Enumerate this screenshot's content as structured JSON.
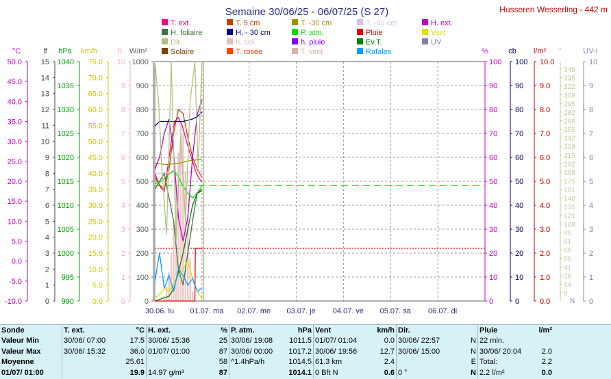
{
  "chart_data": {
    "type": "line",
    "title": "Semaine 30/06/25 - 06/07/25 (S 27)",
    "station": "Husseren Wesserling - 442 m",
    "x_tick_labels": [
      "30.06. lu",
      "01.07. ma",
      "02.07. me",
      "03.07. je",
      "04.07. ve",
      "05.07. sa",
      "06.07. di"
    ],
    "axes": {
      "temp": {
        "unit": "°C",
        "color": "#c000c0",
        "ticks": [
          "50.0",
          "45.0",
          "40.0",
          "35.0",
          "30.0",
          "25.0",
          "20.0",
          "15.0",
          "10.0",
          "5.0",
          "0.0",
          "-5.0",
          "-10.0"
        ],
        "range": [
          -10,
          50
        ]
      },
      "lf": {
        "unit": "lf",
        "color": "#404040",
        "ticks": [
          "15",
          "14",
          "13",
          "12",
          "11",
          "10",
          "9",
          "8",
          "7",
          "6",
          "5",
          "4",
          "3",
          "2",
          "1",
          "0"
        ],
        "range": [
          0,
          15
        ]
      },
      "hpa": {
        "unit": "hPa",
        "color": "#00a000",
        "ticks": [
          "1040",
          "1035",
          "1030",
          "1025",
          "1020",
          "1015",
          "1010",
          "1005",
          "1000",
          "995",
          "990"
        ],
        "range": [
          990,
          1040
        ]
      },
      "kmh": {
        "unit": "km/h",
        "color": "#c8c800",
        "ticks": [
          "75.0",
          "70.0",
          "65.0",
          "60.0",
          "55.0",
          "50.0",
          "45.0",
          "40.0",
          "35.0",
          "30.0",
          "25.0",
          "20.0",
          "15.0",
          "10.0",
          "5.0",
          "0.0"
        ],
        "range": [
          0,
          75
        ]
      },
      "h": {
        "unit": "h",
        "color": "#f0b0b0",
        "ticks": [
          "10",
          "9",
          "8",
          "7",
          "6",
          "5",
          "4",
          "3",
          "2",
          "1",
          "0"
        ],
        "range": [
          0,
          10
        ]
      },
      "wm2": {
        "unit": "W/m²",
        "color": "#606060",
        "ticks": [
          "1000",
          "900",
          "800",
          "700",
          "600",
          "500",
          "400",
          "300",
          "200",
          "100",
          "0"
        ],
        "range": [
          0,
          1000
        ]
      },
      "pct": {
        "unit": "%",
        "color": "#c000c0",
        "ticks": [
          "100",
          "90",
          "80",
          "70",
          "60",
          "50",
          "40",
          "30",
          "20",
          "10",
          "0"
        ],
        "range": [
          0,
          100
        ]
      },
      "cb": {
        "unit": "cb",
        "color": "#000060",
        "ticks": [
          "100",
          "90",
          "80",
          "70",
          "60",
          "50",
          "40",
          "30",
          "20",
          "10",
          "0"
        ],
        "range": [
          0,
          100
        ]
      },
      "lm2": {
        "unit": "l/m²",
        "color": "#c00000",
        "ticks": [
          "10.0",
          "9.0",
          "8.0",
          "7.0",
          "6.0",
          "5.0",
          "4.0",
          "3.0",
          "2.0",
          "1.0",
          "0.0"
        ],
        "range": [
          0,
          10
        ]
      },
      "deg": {
        "unit": "°",
        "color": "#c8c8a0",
        "ticks": [
          "349",
          "335",
          "322",
          "309",
          "295",
          "282",
          "268",
          "255",
          "242",
          "228",
          "215",
          "202",
          "188",
          "175",
          "161",
          "148",
          "135",
          "121",
          "108",
          "95",
          "81",
          "68",
          "55",
          "41",
          "28",
          "14",
          "0"
        ],
        "range": [
          0,
          360
        ],
        "extra_labels": [
          "N",
          "N",
          "E"
        ]
      },
      "uv": {
        "unit": "UV-I",
        "color": "#8080b0",
        "ticks": [
          "10",
          "9",
          "8",
          "7",
          "6",
          "5",
          "4",
          "3",
          "2",
          "1",
          "0"
        ],
        "range": [
          0,
          10
        ]
      }
    },
    "legend": [
      {
        "label": "T. ext.",
        "color": "#ff0080"
      },
      {
        "label": "T. 5 cm",
        "color": "#c04000"
      },
      {
        "label": "T. -30 cm",
        "color": "#a09000"
      },
      {
        "label": "T. -80 cm",
        "color": "#d8c0e8"
      },
      {
        "label": "H. ext.",
        "color": "#c000c0"
      },
      {
        "label": "H. foliaire",
        "color": "#407040"
      },
      {
        "label": "H. - 30 cm",
        "color": "#000080"
      },
      {
        "label": "P. atm.",
        "color": "#00e000"
      },
      {
        "label": "Pluie",
        "color": "#e00000"
      },
      {
        "label": "Vent",
        "color": "#e0e000"
      },
      {
        "label": "Dir.",
        "color": "#b0c080"
      },
      {
        "label": "h. sol.",
        "color": "#e0c0c0"
      },
      {
        "label": "h. pluie",
        "color": "#8000ff"
      },
      {
        "label": "Ev.T.",
        "color": "#008000"
      },
      {
        "label": "UV",
        "color": "#8080b0"
      },
      {
        "label": "Solaire",
        "color": "#804000"
      },
      {
        "label": "T. rosée",
        "color": "#ff4000"
      },
      {
        "label": "T. vent",
        "color": "#e0b0a0"
      },
      {
        "label": "Rafales",
        "color": "#00a0ff"
      }
    ],
    "series": [
      {
        "name": "T. ext.",
        "axis": "temp",
        "color": "#ff0080",
        "x": [
          0,
          0.05,
          0.12,
          0.2,
          0.28,
          0.35,
          0.42,
          0.5,
          0.58,
          0.65,
          0.72,
          0.8,
          0.88,
          0.95,
          1.0
        ],
        "y": [
          22,
          20.5,
          18.5,
          17.5,
          24,
          30,
          35,
          36,
          34,
          31,
          28,
          25,
          22,
          20.5,
          19.9
        ]
      },
      {
        "name": "T. 5 cm",
        "axis": "temp",
        "color": "#c04000",
        "x": [
          0,
          0.1,
          0.2,
          0.3,
          0.4,
          0.5,
          0.6,
          0.7,
          0.8,
          0.9,
          1.0
        ],
        "y": [
          21,
          19,
          18,
          23,
          32,
          38,
          37,
          31,
          26,
          23,
          21
        ]
      },
      {
        "name": "T. -30 cm",
        "axis": "temp",
        "color": "#a09000",
        "x": [
          0,
          0.25,
          0.5,
          0.75,
          1.0
        ],
        "y": [
          24.5,
          24.2,
          24.5,
          25.2,
          25.5
        ]
      },
      {
        "name": "T. -80 cm",
        "axis": "temp",
        "color": "#d8c0e8",
        "x": [
          0,
          0.5,
          1.0
        ],
        "y": [
          22,
          22.2,
          22.5
        ]
      },
      {
        "name": "H. ext.",
        "axis": "pct",
        "color": "#c000c0",
        "x": [
          0,
          0.1,
          0.2,
          0.3,
          0.4,
          0.5,
          0.6,
          0.7,
          0.8,
          0.9,
          1.0
        ],
        "y": [
          55,
          60,
          70,
          76,
          62,
          35,
          25,
          35,
          60,
          78,
          84
        ]
      },
      {
        "name": "H. foliaire",
        "axis": "lf",
        "color": "#407040",
        "x": [
          0,
          0.2,
          0.4,
          0.5,
          0.6,
          0.7,
          0.8,
          0.9,
          1.0
        ],
        "y": [
          7,
          8,
          5,
          2,
          1,
          3,
          5,
          6.8,
          7
        ]
      },
      {
        "name": "H. - 30 cm",
        "axis": "cb",
        "color": "#000080",
        "x": [
          0,
          0.1,
          0.2,
          0.4,
          0.6,
          0.8,
          0.9,
          1.0
        ],
        "y": [
          73,
          75,
          75,
          75,
          75,
          76,
          77,
          79
        ]
      },
      {
        "name": "P. atm.",
        "axis": "hpa",
        "color": "#00e000",
        "x": [
          0,
          0.1,
          0.2,
          0.3,
          0.4,
          0.5,
          0.6,
          0.7,
          0.8,
          0.9,
          1.0
        ],
        "y": [
          1014.5,
          1014.8,
          1015.5,
          1016.5,
          1017.2,
          1016.0,
          1014.0,
          1012.5,
          1011.5,
          1012.5,
          1014.1
        ]
      },
      {
        "name": "Vent",
        "axis": "kmh",
        "color": "#e0e000",
        "x": [
          0,
          0.1,
          0.2,
          0.3,
          0.4,
          0.5,
          0.6,
          0.7,
          0.8,
          0.9,
          1.0
        ],
        "y": [
          1,
          2,
          4,
          3,
          6,
          8,
          10,
          12.7,
          7,
          3,
          0.6
        ]
      },
      {
        "name": "Dir.",
        "axis": "deg",
        "color": "#b0c080",
        "x": [
          0,
          0.08,
          0.15,
          0.25,
          0.35,
          0.45,
          0.55,
          0.65,
          0.75,
          0.85,
          0.92,
          1.0
        ],
        "y": [
          360,
          300,
          200,
          100,
          360,
          90,
          250,
          120,
          300,
          360,
          200,
          360
        ]
      },
      {
        "name": "Ev.T.",
        "axis": "lm2",
        "color": "#008000",
        "x": [
          0,
          0.3,
          0.4,
          0.5,
          0.6,
          0.7,
          0.8,
          0.9,
          1.0
        ],
        "y": [
          0,
          0.2,
          0.5,
          1.2,
          2.0,
          3.0,
          4.0,
          4.5,
          4.6
        ]
      },
      {
        "name": "Pluie",
        "axis": "lm2",
        "color": "#e00000",
        "x": [
          0,
          0.85,
          0.86,
          1.0
        ],
        "y": [
          0,
          0,
          2.2,
          2.2
        ]
      },
      {
        "name": "Rafales",
        "axis": "kmh",
        "color": "#00a0ff",
        "x": [
          0,
          0.1,
          0.2,
          0.3,
          0.4,
          0.5,
          0.6,
          0.7,
          0.8,
          0.9,
          1.0
        ],
        "y": [
          6,
          15,
          4,
          8,
          3,
          10,
          8,
          5,
          7,
          3,
          4
        ]
      }
    ],
    "solar_bars": {
      "axis": "wm2",
      "x": [
        0.2,
        0.25,
        0.3,
        0.35,
        0.4,
        0.45,
        0.5,
        0.55,
        0.6,
        0.65,
        0.7,
        0.75,
        0.8
      ],
      "y": [
        20,
        60,
        120,
        200,
        320,
        480,
        620,
        750,
        700,
        540,
        360,
        180,
        40
      ]
    },
    "reference_lines": [
      {
        "label": "P. atm.",
        "axis": "hpa",
        "value": 1014.1,
        "color": "#00e000",
        "style": "dashed"
      },
      {
        "label": "Pluie",
        "axis": "lm2",
        "value": 2.2,
        "color": "#e00000",
        "style": "dotted"
      }
    ],
    "data_span_days": [
      0,
      1
    ],
    "x_range_days": [
      0,
      7
    ]
  },
  "stats": {
    "rows": [
      "Sonde",
      "Valeur Min",
      "Valeur Max",
      "Moyenne",
      "01/07/ 01:00"
    ],
    "text_ext": {
      "header": "T. ext.",
      "unit": "°C",
      "dates": [
        "30/06/ 07:00",
        "30/06/ 15:32",
        "",
        ""
      ],
      "values": [
        "17.5",
        "36.0",
        "25.61",
        "19.9"
      ]
    },
    "hum": {
      "header": "H. ext.",
      "unit": "%",
      "dates": [
        "30/06/ 15:36",
        "01/07/ 01:00",
        "",
        "14.97 g/m³"
      ],
      "values": [
        "25",
        "87",
        "58",
        "87"
      ]
    },
    "patm": {
      "header": "P. atm.",
      "unit": "hPa",
      "dates": [
        "30/06/ 19:08",
        "30/06/ 00:00",
        "^1.4hPa/h",
        ""
      ],
      "values": [
        "1011.5",
        "1017.2",
        "1014.5",
        "1014.1"
      ]
    },
    "vent": {
      "header": "Vent",
      "unit": "km/h",
      "dates": [
        "01/07/ 01:04",
        "30/06/ 19:56",
        "61.3 km",
        "0 Bft N"
      ],
      "values": [
        "0.0",
        "12.7",
        "2.4",
        "0.6"
      ]
    },
    "dir": {
      "header": "Dir.",
      "dates": [
        "30/06/ 22:57",
        "30/06/ 15:00",
        "",
        "0 °"
      ],
      "values": [
        "N",
        "N",
        "E",
        "N"
      ]
    },
    "pluie": {
      "header": "Pluie",
      "unit": "l/m²",
      "dates": [
        "22 min.",
        "30/06/ 20:04",
        "Total:",
        "2.2 l/m²"
      ],
      "values": [
        "",
        "2.0",
        "2.2",
        "0.0"
      ]
    }
  }
}
